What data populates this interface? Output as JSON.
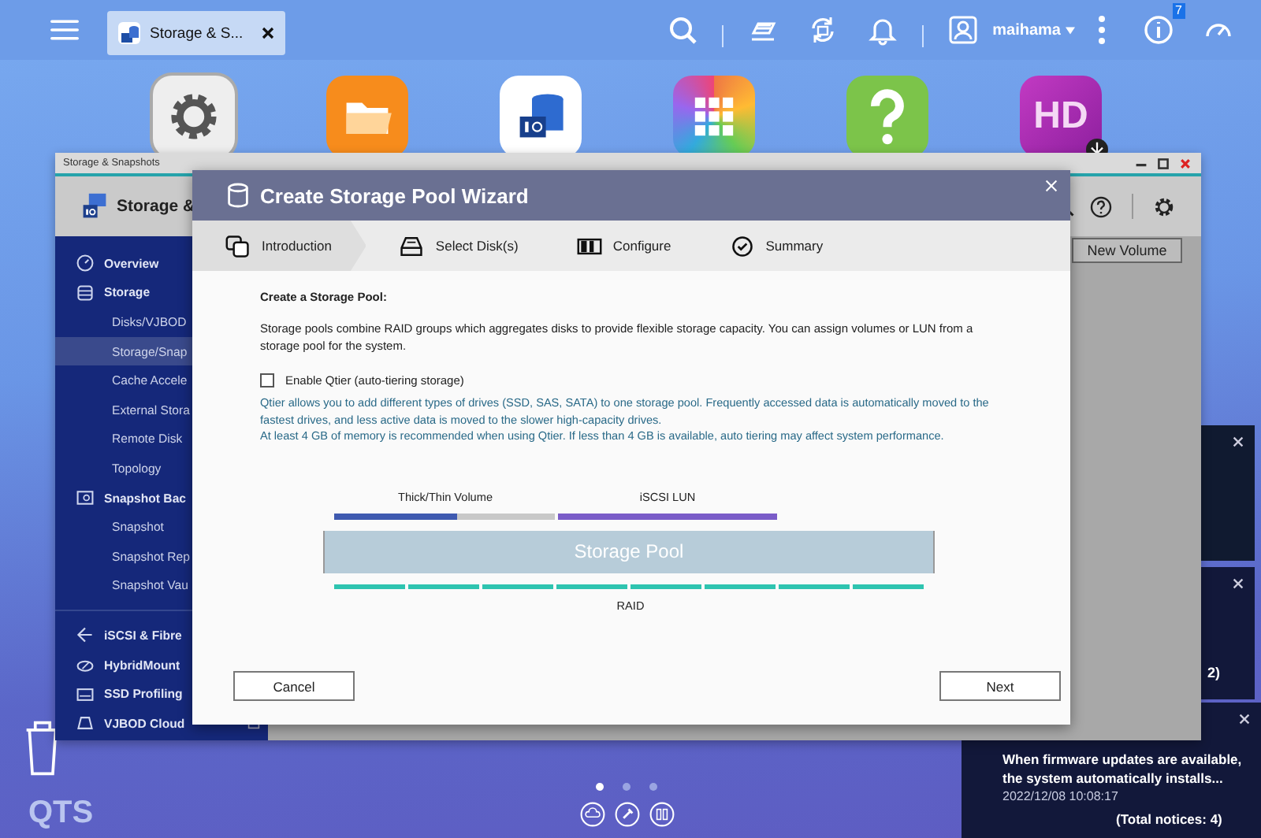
{
  "taskbar": {
    "tabs": [
      {
        "label": "Storage & S...",
        "selected": true
      }
    ],
    "user": "maihama",
    "info_badge": "7"
  },
  "desktop": {
    "hd_app_logo": "HD",
    "brand": "QTS",
    "page_dots": [
      {
        "selected": true
      },
      {
        "selected": false
      },
      {
        "selected": false
      }
    ]
  },
  "background_window": {
    "title": "Storage & Snapshots",
    "header": "Storage &",
    "button": "New Volume",
    "sidebar": [
      {
        "label": "Overview",
        "selected": false
      },
      {
        "label": "Storage",
        "selected": false,
        "children": [
          {
            "label": "Disks/VJBOD",
            "selected": false
          },
          {
            "label": "Storage/Snap",
            "selected": true
          },
          {
            "label": "Cache Accele",
            "selected": false
          },
          {
            "label": "External Stora",
            "selected": false
          },
          {
            "label": "Remote Disk",
            "selected": false
          },
          {
            "label": "Topology",
            "selected": false
          }
        ]
      },
      {
        "label": "Snapshot Bac",
        "selected": false,
        "children": [
          {
            "label": "Snapshot",
            "selected": false
          },
          {
            "label": "Snapshot Rep",
            "selected": false
          },
          {
            "label": "Snapshot Vau",
            "selected": false
          }
        ]
      },
      {
        "label": "iSCSI & Fibre",
        "selected": false
      },
      {
        "label": "HybridMount",
        "selected": false
      },
      {
        "label": "SSD Profiling",
        "selected": false
      },
      {
        "label": "VJBOD Cloud",
        "selected": false
      }
    ]
  },
  "wizard": {
    "title": "Create Storage Pool Wizard",
    "steps": [
      {
        "label": "Introduction",
        "selected": true
      },
      {
        "label": "Select Disk(s)",
        "selected": false
      },
      {
        "label": "Configure",
        "selected": false
      },
      {
        "label": "Summary",
        "selected": false
      }
    ],
    "heading": "Create a Storage Pool:",
    "description": "Storage pools combine RAID groups which aggregates disks to provide flexible storage capacity. You can assign volumes or LUN from a storage pool for the system.",
    "qtier": {
      "label": "Enable Qtier (auto-tiering storage)",
      "checked": false
    },
    "notes": [
      "Qtier allows you to add different types of drives (SSD, SAS, SATA) to one storage pool. Frequently accessed data is automatically moved to the fastest drives, and less active data is moved to the slower high-capacity drives.",
      "At least 4 GB of memory is recommended when using Qtier. If less than 4 GB is available, auto tiering may affect system performance."
    ],
    "diagram": {
      "volume_label": "Thick/Thin Volume",
      "lun_label": "iSCSI LUN",
      "pool_label": "Storage Pool",
      "raid_label": "RAID"
    },
    "buttons": {
      "cancel": "Cancel",
      "next": "Next"
    }
  },
  "notifications": {
    "items": [
      {
        "text": "2)"
      },
      {
        "text": "When firmware updates are available, the system automatically installs...",
        "time": "2022/12/08 10:08:17"
      }
    ],
    "total": "(Total notices: 4)"
  }
}
